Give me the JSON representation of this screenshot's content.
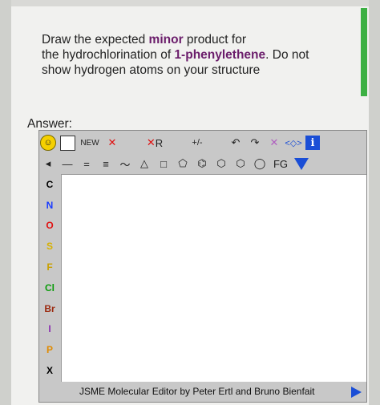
{
  "question": {
    "line1_pre": "Draw the expected ",
    "line1_hl": "minor",
    "line1_post": " product for",
    "line2_pre": "the hydrochlorination of ",
    "line2_hl": "1-phenylethene",
    "line2_post": ". Do not",
    "line3": "show hydrogen atoms on your structure"
  },
  "answer_label": "Answer:",
  "editor": {
    "toolbar_top": {
      "new_label": "NEW",
      "delete_glyph": "✕",
      "rgroup_label": "R",
      "charge_label": "+/-",
      "info_label": "i"
    },
    "toolbar_bonds": {
      "fg_label": "FG"
    },
    "atoms": [
      {
        "symbol": "C",
        "color": "#000000"
      },
      {
        "symbol": "N",
        "color": "#1a3cff"
      },
      {
        "symbol": "O",
        "color": "#e01010"
      },
      {
        "symbol": "S",
        "color": "#d7b000"
      },
      {
        "symbol": "F",
        "color": "#c9a000"
      },
      {
        "symbol": "Cl",
        "color": "#0a9c0a"
      },
      {
        "symbol": "Br",
        "color": "#9b2a10"
      },
      {
        "symbol": "I",
        "color": "#8a2fb0"
      },
      {
        "symbol": "P",
        "color": "#e08a00"
      },
      {
        "symbol": "X",
        "color": "#000000"
      }
    ],
    "status_text": "JSME Molecular Editor by Peter Ertl and Bruno Bienfait"
  },
  "colors": {
    "accent_green": "#3cb043",
    "highlight_purple": "#6b1d6b",
    "jsme_blue": "#1a4ed6"
  }
}
